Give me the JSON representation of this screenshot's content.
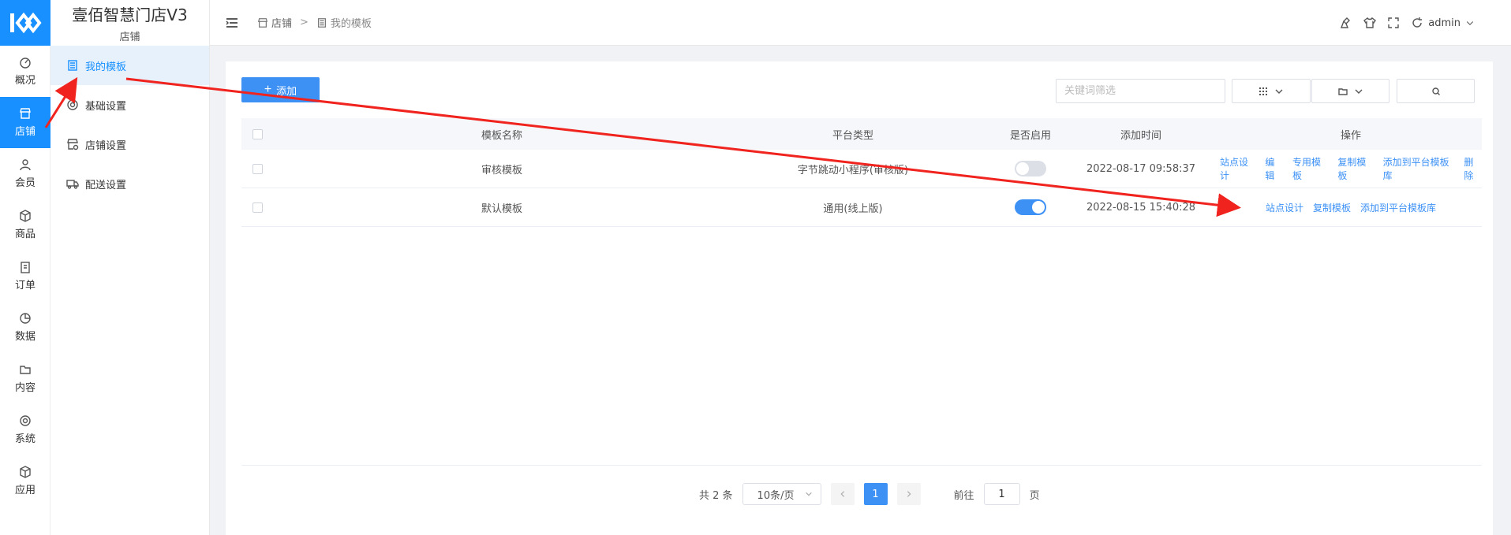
{
  "app": {
    "title": "壹佰智慧门店V3",
    "subtitle": "店铺"
  },
  "rail": [
    {
      "label": "概况",
      "icon": "dashboard-icon"
    },
    {
      "label": "店铺",
      "icon": "store-icon",
      "active": true
    },
    {
      "label": "会员",
      "icon": "user-icon"
    },
    {
      "label": "商品",
      "icon": "box-icon"
    },
    {
      "label": "订单",
      "icon": "clipboard-icon"
    },
    {
      "label": "数据",
      "icon": "pie-chart-icon"
    },
    {
      "label": "内容",
      "icon": "folder-icon"
    },
    {
      "label": "系统",
      "icon": "gear-icon"
    },
    {
      "label": "应用",
      "icon": "cube-icon"
    }
  ],
  "side": [
    {
      "label": "我的模板",
      "icon": "template-icon",
      "active": true
    },
    {
      "label": "基础设置",
      "icon": "gear-icon"
    },
    {
      "label": "店铺设置",
      "icon": "store-settings-icon"
    },
    {
      "label": "配送设置",
      "icon": "truck-icon"
    }
  ],
  "breadcrumb": {
    "parent": "店铺",
    "sep": ">",
    "current": "我的模板"
  },
  "header": {
    "user": "admin"
  },
  "toolbar": {
    "add_label": "添加",
    "search_placeholder": "关键词筛选"
  },
  "table": {
    "columns": [
      "模板名称",
      "平台类型",
      "是否启用",
      "添加时间",
      "操作"
    ],
    "rows": [
      {
        "name": "审核模板",
        "platform": "字节跳动小程序(审核版)",
        "enabled": false,
        "time": "2022-08-17 09:58:37",
        "ops": [
          "站点设计",
          "编辑",
          "专用模板",
          "复制模板",
          "添加到平台模板库",
          "删除"
        ]
      },
      {
        "name": "默认模板",
        "platform": "通用(线上版)",
        "enabled": true,
        "time": "2022-08-15 15:40:28",
        "ops": [
          "站点设计",
          "复制模板",
          "添加到平台模板库"
        ]
      }
    ]
  },
  "pagination": {
    "total": "共 2 条",
    "page_size": "10条/页",
    "current": "1",
    "goto_prefix": "前往",
    "goto_value": "1",
    "goto_suffix": "页"
  },
  "colors": {
    "primary": "#1890ff",
    "link": "#3d91f5",
    "annotation": "#f0231e"
  }
}
